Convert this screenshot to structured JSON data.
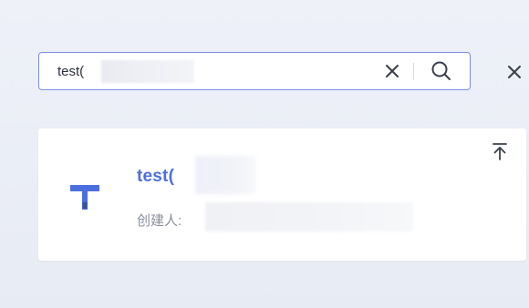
{
  "search": {
    "value": "test("
  },
  "result": {
    "title": "test(",
    "creator_label": "创建人:"
  },
  "icons": {
    "clear": "close-icon",
    "search": "search-icon",
    "close_panel": "close-icon",
    "pin_top": "pin-to-top-icon",
    "doc_type": "text-document-icon"
  },
  "colors": {
    "accent": "#4c6fe0",
    "input_border": "#7b8ee6",
    "background": "#e9edf6"
  }
}
